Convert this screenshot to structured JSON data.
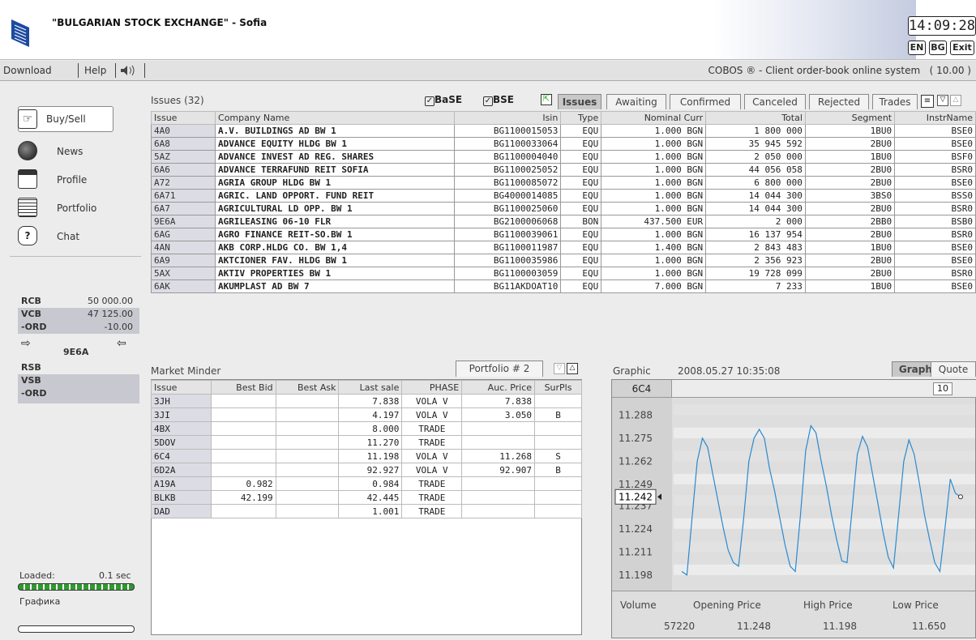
{
  "header": {
    "title": "\"BULGARIAN STOCK EXCHANGE\" - Sofia",
    "clock": "14:09:28",
    "lang_en": "EN",
    "lang_bg": "BG",
    "exit": "Exit"
  },
  "menu": {
    "download": "Download",
    "help": "Help",
    "system": "COBOS ® - Client order-book online system",
    "version": "( 10.00 )"
  },
  "nav": [
    {
      "label": "Buy/Sell",
      "icon": "handshake-icon"
    },
    {
      "label": "News",
      "icon": "globe-icon"
    },
    {
      "label": "Profile",
      "icon": "document-icon"
    },
    {
      "label": "Portfolio",
      "icon": "grid-icon"
    },
    {
      "label": "Chat",
      "icon": "question-icon"
    }
  ],
  "stats": [
    {
      "k": "RCB",
      "v": "50 000.00"
    },
    {
      "k": "VCB",
      "v": "47 125.00"
    },
    {
      "k": "-ORD",
      "v": "-10.00"
    }
  ],
  "selected_issue": "9E6A",
  "stats2": [
    {
      "k": "RSB",
      "v": ""
    },
    {
      "k": "VSB",
      "v": ""
    },
    {
      "k": "-ORD",
      "v": ""
    }
  ],
  "loaded": {
    "label": "Loaded:",
    "value": "0.1 sec",
    "caption": "Графика"
  },
  "issues": {
    "title": "Issues (32)",
    "filter_base": "BaSE",
    "filter_bse": "BSE",
    "tabs": [
      "Issues",
      "Awaiting",
      "Confirmed",
      "Canceled",
      "Rejected",
      "Trades"
    ],
    "columns": [
      "Issue",
      "Company Name",
      "Isin",
      "Type",
      "Nominal Curr",
      "Total",
      "Segment",
      "InstrName"
    ],
    "rows": [
      [
        "4A0",
        "A.V. BUILDINGS AD    BW 1",
        "BG1100015053",
        "EQU",
        "1.000 BGN",
        "1 800 000",
        "1BU0",
        "BSE0"
      ],
      [
        "6A8",
        "ADVANCE EQUITY HLDG BW 1",
        "BG1100033064",
        "EQU",
        "1.000 BGN",
        "35 945 592",
        "2BU0",
        "BSE0"
      ],
      [
        "5AZ",
        "ADVANCE INVEST AD REG. SHARES",
        "BG1100004040",
        "EQU",
        "1.000 BGN",
        "2 050 000",
        "1BU0",
        "BSF0"
      ],
      [
        "6A6",
        "ADVANCE TERRAFUND REIT SOFIA",
        "BG1100025052",
        "EQU",
        "1.000 BGN",
        "44 056 058",
        "2BU0",
        "BSR0"
      ],
      [
        "A72",
        "AGRIA GROUP HLDG    BW 1",
        "BG1100085072",
        "EQU",
        "1.000 BGN",
        "6 800 000",
        "2BU0",
        "BSE0"
      ],
      [
        "6A71",
        "AGRIC. LAND OPPORT. FUND REIT",
        "BG4000014085",
        "EQU",
        "1.000 BGN",
        "14 044 300",
        "3BS0",
        "BSS0"
      ],
      [
        "6A7",
        "AGRICULTURAL LD OPP. BW 1",
        "BG1100025060",
        "EQU",
        "1.000 BGN",
        "14 044 300",
        "2BU0",
        "BSR0"
      ],
      [
        "9E6A",
        "AGRILEASING 06-10 FLR",
        "BG2100006068",
        "BON",
        "437.500 EUR",
        "2 000",
        "2BB0",
        "BSB0"
      ],
      [
        "6AG",
        "AGRO FINANCE REIT-SO.BW 1",
        "BG1100039061",
        "EQU",
        "1.000 BGN",
        "16 137 954",
        "2BU0",
        "BSR0"
      ],
      [
        "4AN",
        "AKB CORP.HLDG CO.  BW 1,4",
        "BG1100011987",
        "EQU",
        "1.400 BGN",
        "2 843 483",
        "1BU0",
        "BSE0"
      ],
      [
        "6A9",
        "AKTCIONER FAV. HLDG  BW 1",
        "BG1100035986",
        "EQU",
        "1.000 BGN",
        "2 356 923",
        "2BU0",
        "BSE0"
      ],
      [
        "5AX",
        "AKTIV PROPERTIES    BW 1",
        "BG1100003059",
        "EQU",
        "1.000 BGN",
        "19 728 099",
        "2BU0",
        "BSR0"
      ],
      [
        "6AK",
        "AKUMPLAST AD        BW 7",
        "BG11AKDOAT10",
        "EQU",
        "7.000 BGN",
        "7 233",
        "1BU0",
        "BSE0"
      ]
    ]
  },
  "market": {
    "title": "Market Minder",
    "portfolio": "Portfolio # 2",
    "columns": [
      "Issue",
      "Best Bid",
      "Best Ask",
      "Last sale",
      "PHASE",
      "Auc. Price",
      "SurPls"
    ],
    "rows": [
      [
        "3JH",
        "",
        "",
        "7.838",
        "VOLA V",
        "7.838",
        ""
      ],
      [
        "3JI",
        "",
        "",
        "4.197",
        "VOLA V",
        "3.050",
        "B"
      ],
      [
        "4BX",
        "",
        "",
        "8.000",
        "TRADE",
        "",
        ""
      ],
      [
        "5DOV",
        "",
        "",
        "11.270",
        "TRADE",
        "",
        ""
      ],
      [
        "6C4",
        "",
        "",
        "11.198",
        "VOLA V",
        "11.268",
        "S"
      ],
      [
        "6D2A",
        "",
        "",
        "92.927",
        "VOLA V",
        "92.907",
        "B"
      ],
      [
        "A19A",
        "0.982",
        "",
        "0.984",
        "TRADE",
        "",
        ""
      ],
      [
        "BLKB",
        "42.199",
        "",
        "42.445",
        "TRADE",
        "",
        ""
      ],
      [
        "DAD",
        "",
        "",
        "1.001",
        "TRADE",
        "",
        ""
      ]
    ]
  },
  "graphic": {
    "title": "Graphic",
    "datetime": "2008.05.27  10:35:08",
    "issue": "6C4",
    "interval": "10",
    "tabs": [
      "Graphic",
      "Quote"
    ],
    "current": "11.242",
    "yticks": [
      "11.288",
      "11.275",
      "11.262",
      "11.249",
      "11.237",
      "11.224",
      "11.211",
      "11.198"
    ],
    "volume_label": "Volume",
    "open_label": "Opening Price",
    "high_label": "High Price",
    "low_label": "Low Price",
    "volume": "57220",
    "open": "11.248",
    "high": "11.198",
    "low": "11.650"
  },
  "chart_data": {
    "type": "line",
    "title": "",
    "series": [
      {
        "name": "",
        "values": [
          11.2,
          11.198,
          11.23,
          11.262,
          11.275,
          11.27,
          11.255,
          11.24,
          11.225,
          11.212,
          11.205,
          11.203,
          11.23,
          11.262,
          11.275,
          11.28,
          11.275,
          11.258,
          11.245,
          11.23,
          11.215,
          11.203,
          11.2,
          11.232,
          11.268,
          11.282,
          11.278,
          11.262,
          11.248,
          11.232,
          11.218,
          11.206,
          11.205,
          11.235,
          11.266,
          11.276,
          11.27,
          11.254,
          11.238,
          11.222,
          11.208,
          11.202,
          11.232,
          11.262,
          11.274,
          11.266,
          11.25,
          11.232,
          11.218,
          11.205,
          11.2,
          11.225,
          11.252,
          11.244,
          11.242
        ]
      }
    ],
    "ylim": [
      11.192,
      11.295
    ]
  },
  "colors": {
    "line": "#2a8ad0",
    "issue_cell": "#dcdce4"
  }
}
